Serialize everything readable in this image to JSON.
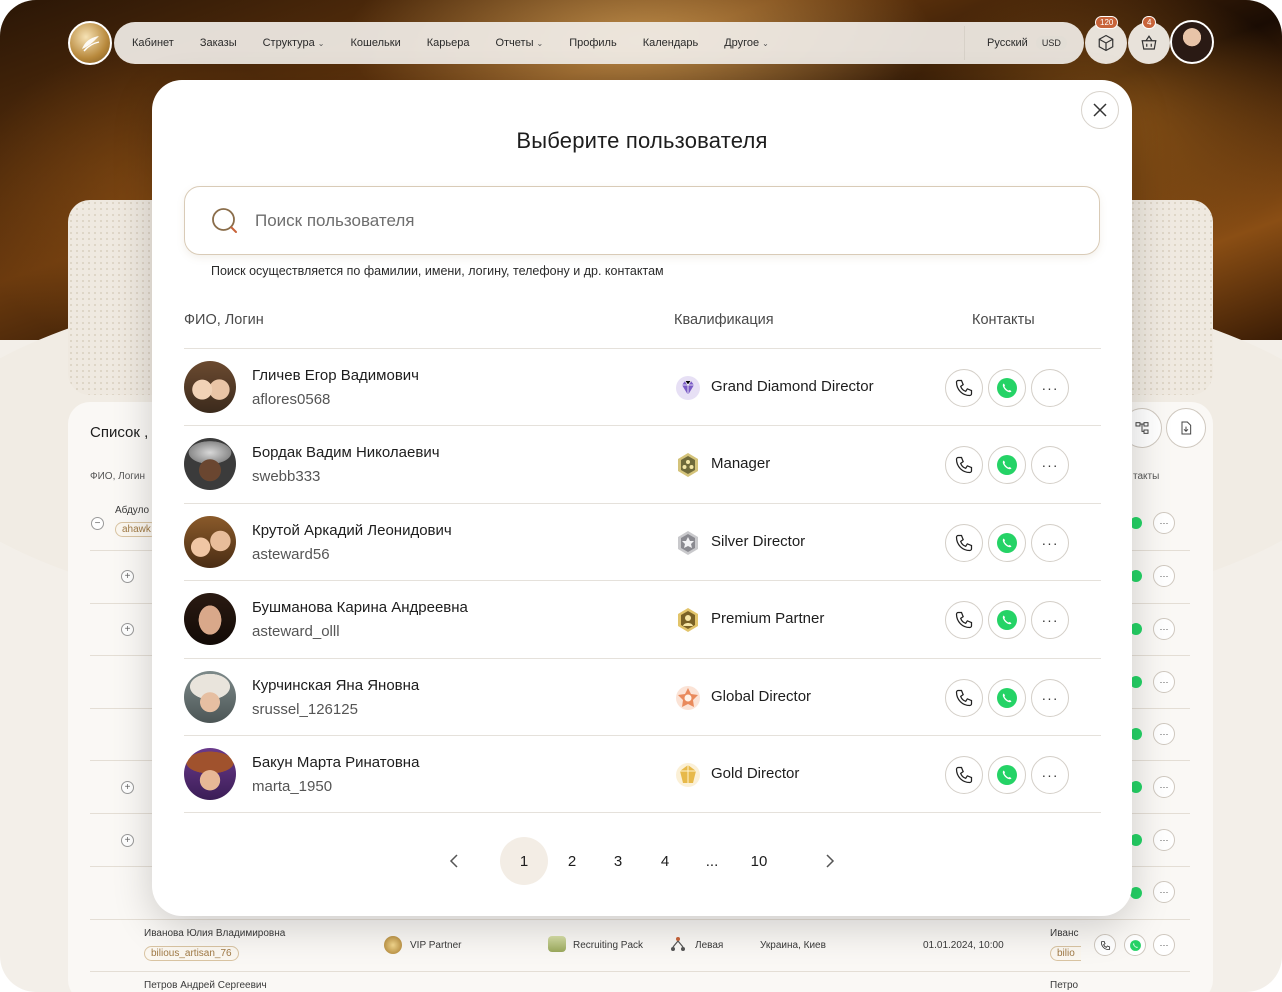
{
  "topnav": {
    "items": [
      {
        "label": "Кабинет",
        "dropdown": false
      },
      {
        "label": "Заказы",
        "dropdown": false
      },
      {
        "label": "Структура",
        "dropdown": true
      },
      {
        "label": "Кошельки",
        "dropdown": false
      },
      {
        "label": "Карьера",
        "dropdown": false
      },
      {
        "label": "Отчеты",
        "dropdown": true
      },
      {
        "label": "Профиль",
        "dropdown": false
      },
      {
        "label": "Календарь",
        "dropdown": false
      },
      {
        "label": "Другое",
        "dropdown": true
      }
    ],
    "language": "Русский",
    "currency": "USD",
    "orders_badge": "120",
    "cart_badge": "4"
  },
  "background": {
    "list_title": "Список ,",
    "col_fio": "ФИО, Логин",
    "col_contacts": "такты",
    "tree_name_1": "Абдуло",
    "tree_tag_1": "ahawk",
    "row_a": {
      "name": "Иванова Юлия Владимировна",
      "login": "bilious_artisan_76",
      "qualification": "VIP Partner",
      "package": "Recruiting Pack",
      "side": "Левая",
      "location": "Украина, Киев",
      "date": "01.01.2024, 10:00",
      "sponsor_name": "Иванс",
      "sponsor_login": "bilio"
    },
    "row_b": {
      "name": "Петров Андрей Сергеевич",
      "sponsor_name": "Петро"
    }
  },
  "modal": {
    "title": "Выберите пользователя",
    "search_placeholder": "Поиск пользователя",
    "search_value": "",
    "search_hint": "Поиск осуществляется по фамилии, имени, логину, телефону и др. контактам",
    "columns": {
      "fio": "ФИО, Логин",
      "qualification": "Квалификация",
      "contacts": "Контакты"
    },
    "users": [
      {
        "name": "Гличев Егор Вадимович",
        "login": "aflores0568",
        "qualification": "Grand Diamond Director",
        "qual_icon": "grand-diamond-icon"
      },
      {
        "name": "Бордак Вадим Николаевич",
        "login": "swebb333",
        "qualification": "Manager",
        "qual_icon": "manager-icon"
      },
      {
        "name": "Крутой Аркадий Леонидович",
        "login": "asteward56",
        "qualification": "Silver Director",
        "qual_icon": "silver-director-icon"
      },
      {
        "name": "Бушманова Карина Андреевна",
        "login": "asteward_olll",
        "qualification": "Premium Partner",
        "qual_icon": "premium-partner-icon"
      },
      {
        "name": "Курчинская Яна Яновна",
        "login": "srussel_126125",
        "qualification": "Global Director",
        "qual_icon": "global-director-icon"
      },
      {
        "name": "Бакун Марта Ринатовна",
        "login": "marta_1950",
        "qualification": "Gold Director",
        "qual_icon": "gold-director-icon"
      }
    ],
    "more_label": "···",
    "pagination": {
      "pages": [
        "1",
        "2",
        "3",
        "4",
        "...",
        "10"
      ],
      "current": "1"
    }
  },
  "colors": {
    "accent_gold": "#b8893c",
    "whatsapp_green": "#25d366",
    "badge": "#c8643a"
  }
}
